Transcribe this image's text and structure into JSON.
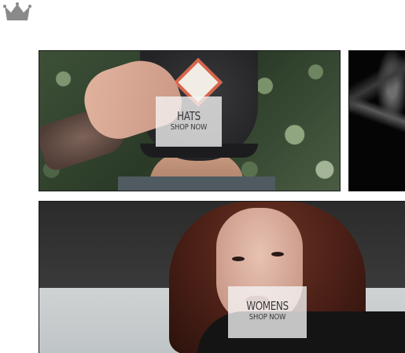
{
  "logo": {
    "icon": "crown-icon",
    "color": "#8a8a8a"
  },
  "tiles": {
    "hats": {
      "title": "HATS",
      "cta": "SHOP NOW"
    },
    "womens": {
      "title": "WOMENS",
      "cta": "SHOP NOW"
    }
  }
}
